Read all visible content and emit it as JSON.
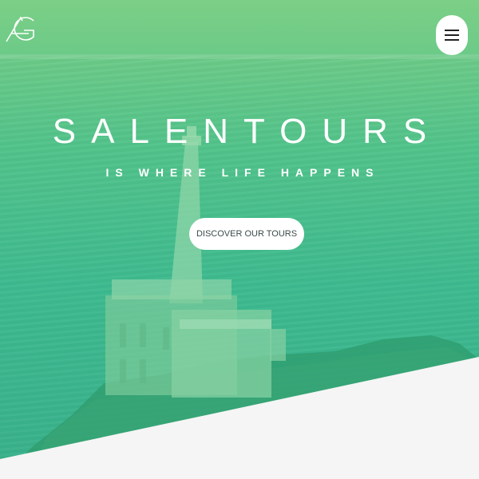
{
  "hero": {
    "title": "SALENTOURS",
    "tagline": "IS WHERE LIFE HAPPENS",
    "cta_label": "DISCOVER OUR TOURS"
  },
  "header": {
    "logo_icon": "ag-monogram-logo",
    "menu_icon": "hamburger-menu-icon"
  },
  "colors": {
    "gradient_top": "#7ccf86",
    "gradient_bottom": "#38b08a",
    "button_bg": "#ffffff",
    "page_bg": "#f5f5f5"
  }
}
